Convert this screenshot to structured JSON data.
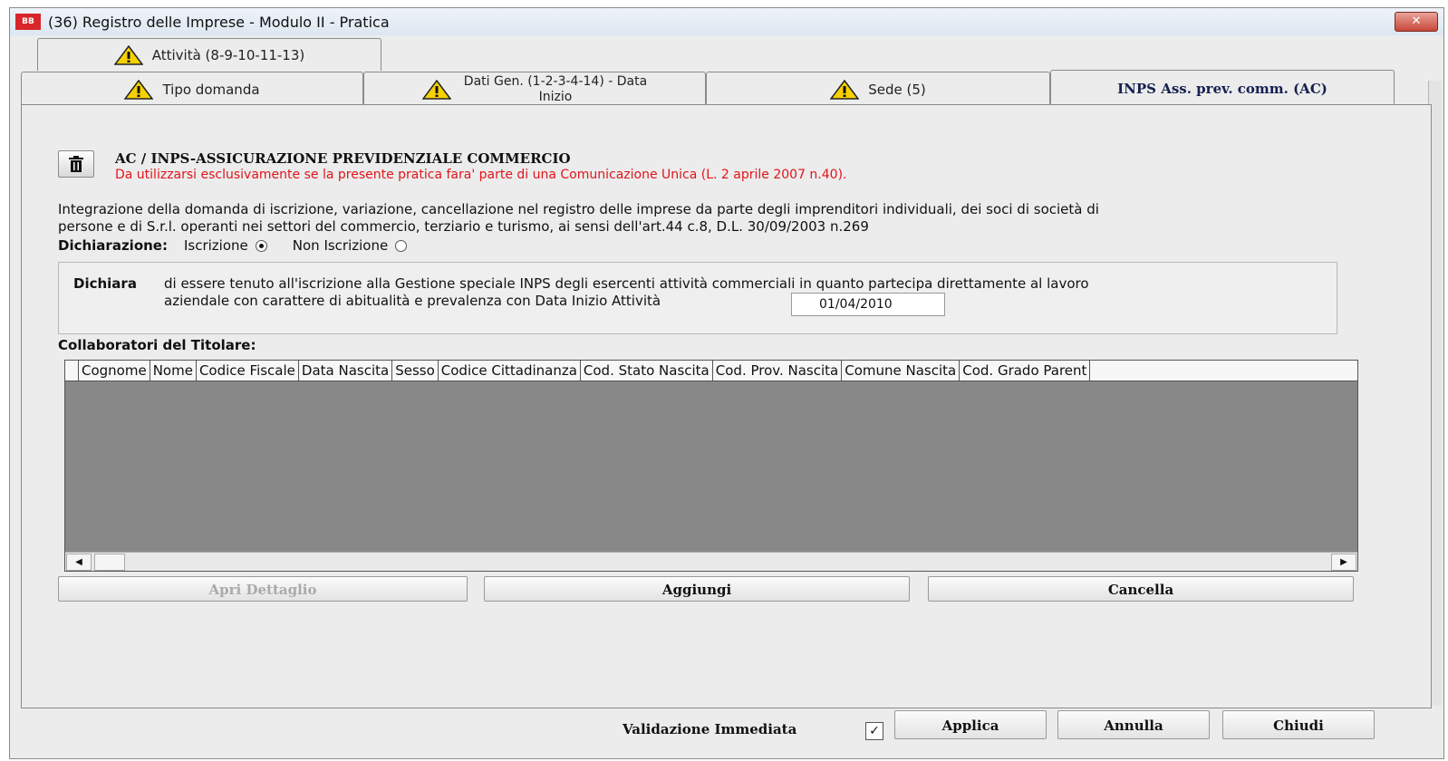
{
  "window": {
    "title": "(36) Registro delle Imprese - Modulo II  - Pratica",
    "app_icon_text": "BB",
    "close_label": "✕"
  },
  "tabs": {
    "row1": [
      {
        "label": "Attività (8-9-10-11-13)",
        "icon": "warning-icon"
      }
    ],
    "row2": [
      {
        "label": "Tipo domanda",
        "icon": "warning-icon"
      },
      {
        "label_line1": "Dati Gen. (1-2-3-4-14) - Data",
        "label_line2": "Inizio",
        "icon": "warning-icon"
      },
      {
        "label": "Sede (5)",
        "icon": "warning-icon"
      },
      {
        "label": "INPS Ass. prev. comm. (AC)",
        "active": true
      }
    ]
  },
  "section": {
    "trash_icon": "trash-icon",
    "heading": "AC / INPS-ASSICURAZIONE PREVIDENZIALE COMMERCIO",
    "warning_note": "Da utilizzarsi esclusivamente se la presente pratica fara' parte di una Comunicazione Unica (L. 2 aprile 2007 n.40).",
    "description_line1": "Integrazione della domanda di iscrizione, variazione, cancellazione nel registro delle imprese da parte degli imprenditori individuali, dei soci di società di",
    "description_line2": "persone e di S.r.l. operanti nei settori del commercio, terziario e turismo, ai sensi dell'art.44 c.8, D.L. 30/09/2003 n.269"
  },
  "declaration": {
    "label": "Dichiarazione:",
    "options": [
      {
        "label": "Iscrizione",
        "selected": true
      },
      {
        "label": "Non Iscrizione",
        "selected": false
      }
    ],
    "box_label": "Dichiara",
    "box_text_line1": "di essere tenuto all'iscrizione alla Gestione speciale INPS degli esercenti attività commerciali in quanto partecipa direttamente al lavoro",
    "box_text_line2": "aziendale con carattere di abitualità e prevalenza con Data Inizio Attività",
    "start_date": "01/04/2010"
  },
  "collaborators": {
    "label": "Collaboratori del Titolare:",
    "columns": [
      "Cognome",
      "Nome",
      "Codice Fiscale",
      "Data Nascita",
      "Sesso",
      "Codice Cittadinanza",
      "Cod. Stato Nascita",
      "Cod. Prov. Nascita",
      "Comune Nascita",
      "Cod. Grado Parent"
    ],
    "rows": []
  },
  "actions": {
    "open_detail": "Apri Dettaglio",
    "add": "Aggiungi",
    "delete": "Cancella"
  },
  "footer": {
    "validation_label": "Validazione Immediata",
    "validation_checked": true,
    "apply": "Applica",
    "cancel": "Annulla",
    "close": "Chiudi"
  },
  "colors": {
    "note_red": "#e2141a",
    "grid_bg": "#888888",
    "active_tab_text": "#152050",
    "close_button": "#c9473a"
  }
}
